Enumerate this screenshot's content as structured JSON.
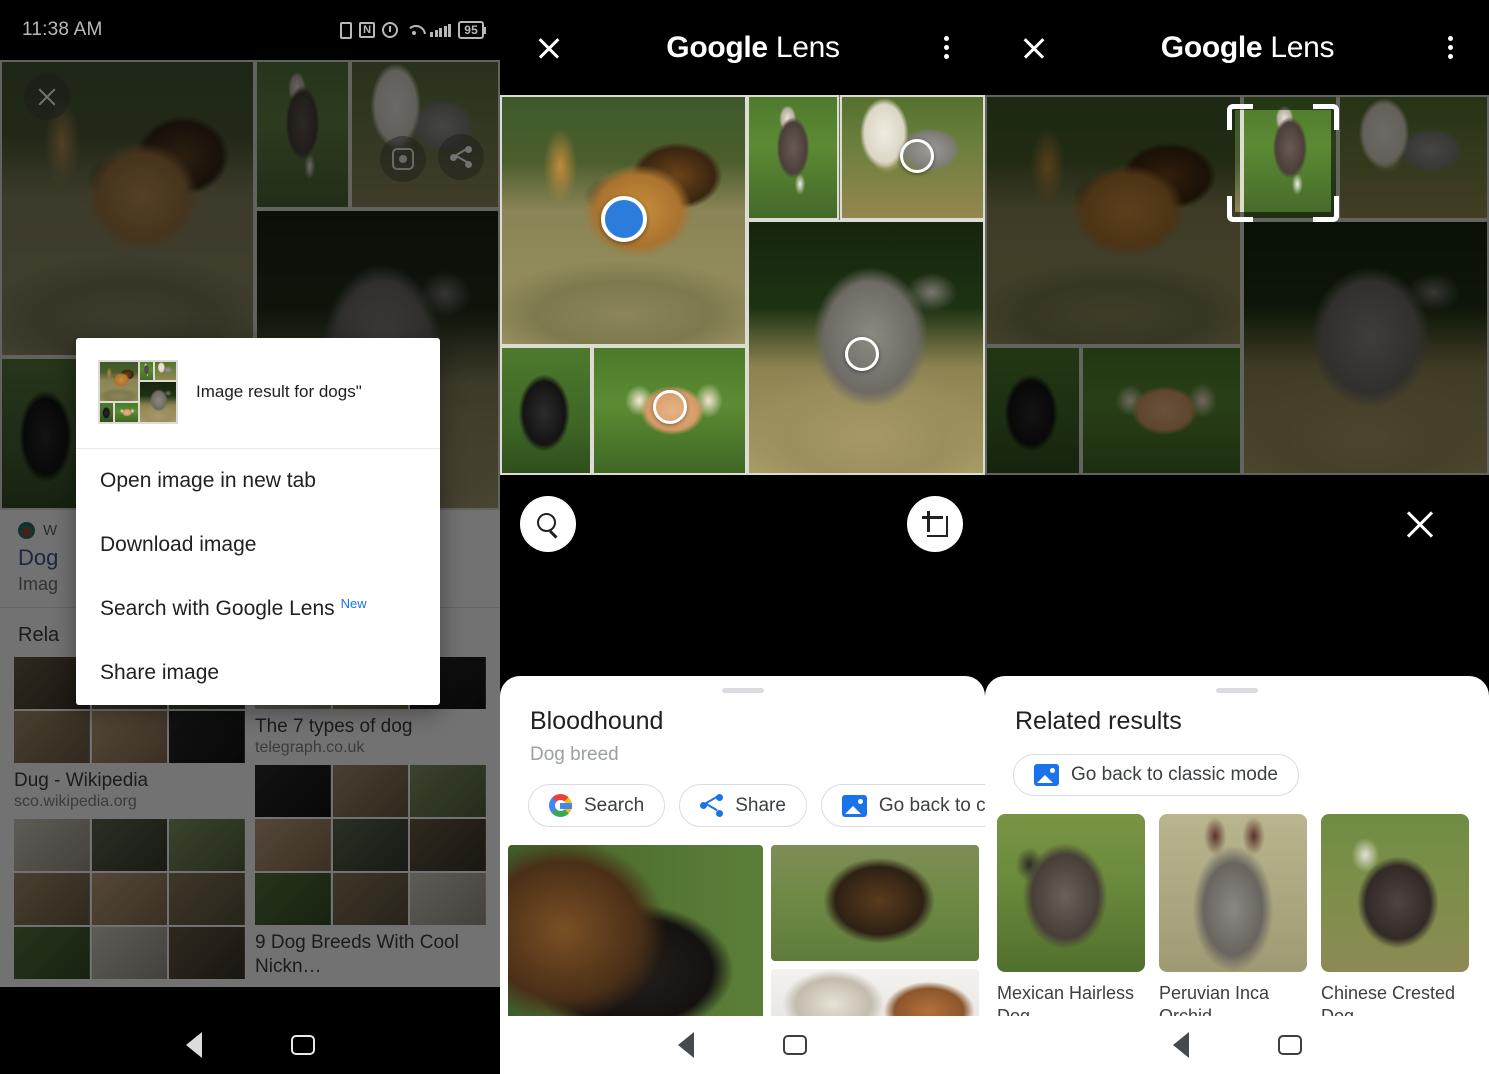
{
  "status_bar": {
    "time": "11:38 AM",
    "battery": "95",
    "icons": [
      "sim-card-icon",
      "nfc-icon",
      "alarm-icon",
      "wifi-icon",
      "signal-bars-icon",
      "battery-icon"
    ]
  },
  "left_panel": {
    "overlay_buttons": {
      "close": "close-icon",
      "lens": "google-lens-icon",
      "share": "share-icon"
    },
    "result": {
      "site_label": "W",
      "title": "Dog",
      "subtitle": "Imag"
    },
    "related_header": "Rela",
    "results": [
      {
        "title": "The 7 types of dog",
        "source": "telegraph.co.uk"
      },
      {
        "title": "Dug - Wikipedia",
        "source": "sco.wikipedia.org"
      },
      {
        "title": "9 Dog Breeds With Cool Nickn…",
        "source": ""
      }
    ],
    "dialog": {
      "header_title": "Image result for dogs\"",
      "items": [
        {
          "label": "Open image in new tab",
          "badge": ""
        },
        {
          "label": "Download image",
          "badge": ""
        },
        {
          "label": "Search with Google Lens",
          "badge": "New"
        },
        {
          "label": "Share image",
          "badge": ""
        }
      ]
    }
  },
  "mid_panel": {
    "app_title_bold": "Google",
    "app_title_light": "Lens",
    "close_icon": "close-icon",
    "menu_icon": "kebab-menu-icon",
    "fabs": {
      "search": "search-icon",
      "crop": "crop-icon"
    },
    "sheet": {
      "title": "Bloodhound",
      "subtitle": "Dog breed",
      "chips": [
        {
          "label": "Search",
          "icon": "google-logo-icon"
        },
        {
          "label": "Share",
          "icon": "share-icon"
        },
        {
          "label": "Go back to classic mod",
          "icon": "image-icon"
        }
      ]
    }
  },
  "right_panel": {
    "app_title_bold": "Google",
    "app_title_light": "Lens",
    "close_icon": "close-icon",
    "menu_icon": "kebab-menu-icon",
    "close_overlay_icon": "close-icon",
    "sheet": {
      "title": "Related results",
      "chip": {
        "label": "Go back to classic mode",
        "icon": "image-icon"
      },
      "cards": [
        {
          "caption": "Mexican Hairless Dog"
        },
        {
          "caption": "Peruvian Inca Orchid"
        },
        {
          "caption": "Chinese Crested Dog"
        }
      ]
    }
  },
  "nav_bar": {
    "back": "back-icon",
    "home": "home-icon"
  },
  "colors": {
    "accent_blue": "#1a73e8",
    "link_blue": "#3c59a8",
    "selection_dot": "#2c7ddb",
    "sheet_bg": "#ffffff",
    "chrome_black": "#000000"
  }
}
